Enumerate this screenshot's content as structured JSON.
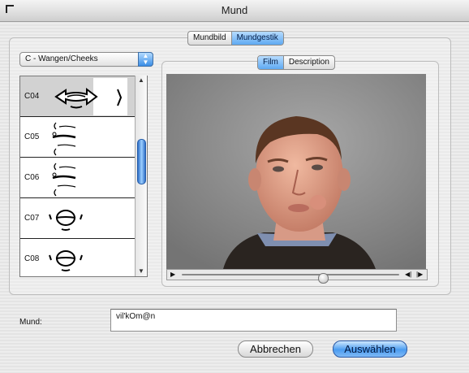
{
  "window": {
    "title": "Mund"
  },
  "top_tabs": [
    {
      "label": "Mundbild",
      "selected": false
    },
    {
      "label": "Mundgestik",
      "selected": true
    }
  ],
  "category_popup": {
    "selected": "C - Wangen/Cheeks"
  },
  "video_tabs": [
    {
      "label": "Film",
      "selected": true
    },
    {
      "label": "Description",
      "selected": false
    }
  ],
  "list": {
    "rows": [
      {
        "code": "C04",
        "selected": true
      },
      {
        "code": "C05"
      },
      {
        "code": "C06"
      },
      {
        "code": "C07"
      },
      {
        "code": "C08"
      }
    ]
  },
  "video": {
    "progress": 0.65
  },
  "form": {
    "mund_label": "Mund:",
    "mund_value": "vil'kOm@n"
  },
  "buttons": {
    "cancel": "Abbrechen",
    "ok": "Auswählen"
  },
  "colors": {
    "accent": "#4b9cf0",
    "selected_row": "#d2d2d2"
  }
}
